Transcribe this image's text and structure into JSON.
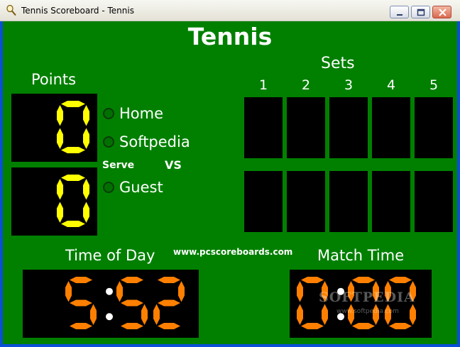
{
  "window": {
    "title": "Tennis Scoreboard - Tennis",
    "icon": "tennis-racket-icon",
    "controls": [
      "minimize-icon",
      "maximize-icon",
      "close-icon"
    ]
  },
  "scoreboard": {
    "title": "Tennis",
    "points_label": "Points",
    "sets_label": "Sets",
    "set_numbers": [
      "1",
      "2",
      "3",
      "4",
      "5"
    ],
    "teams": [
      {
        "name": "Home",
        "points": "0",
        "serving": false
      },
      {
        "name": "Softpedia",
        "serving": false
      },
      {
        "name": "Guest",
        "points": "0",
        "serving": false
      }
    ],
    "serve_label": "Serve",
    "vs_label": "VS",
    "time_of_day_label": "Time of Day",
    "time_of_day": "5:52",
    "website": "www.pcscoreboards.com",
    "match_time_label": "Match Time",
    "match_time": "0:00",
    "watermark": "SOFTPEDIA",
    "watermark_sub": "www.softpedia.com"
  },
  "colors": {
    "background": "#018000",
    "points_digit": "#ffff00",
    "clock_digit": "#ff8000",
    "panel": "#000000"
  }
}
